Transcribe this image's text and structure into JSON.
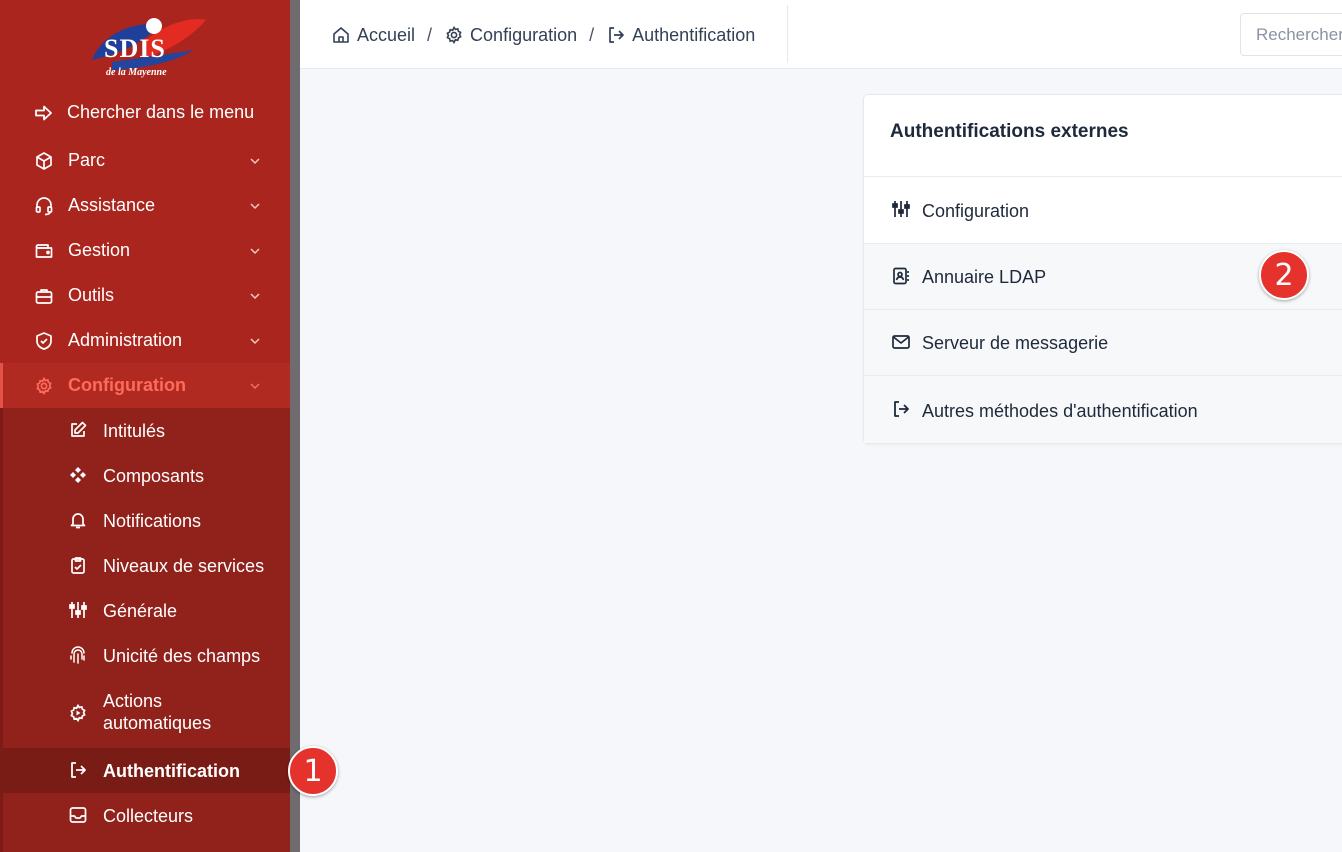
{
  "brand": {
    "logo_text": "SDIS",
    "logo_subtext": "de la Mayenne",
    "colors": {
      "sidebar": "#a9251d",
      "submenu": "#90221b",
      "active_text": "#ff6b5a",
      "badge": "#e5322d"
    }
  },
  "sidebar": {
    "search_label": "Chercher dans le menu",
    "items": [
      {
        "label": "Parc",
        "icon": "box-icon"
      },
      {
        "label": "Assistance",
        "icon": "headset-icon"
      },
      {
        "label": "Gestion",
        "icon": "wallet-icon"
      },
      {
        "label": "Outils",
        "icon": "briefcase-icon"
      },
      {
        "label": "Administration",
        "icon": "shield-icon"
      },
      {
        "label": "Configuration",
        "icon": "gear-icon",
        "active": true
      }
    ],
    "submenu": [
      {
        "label": "Intitulés",
        "icon": "edit-icon"
      },
      {
        "label": "Composants",
        "icon": "components-icon"
      },
      {
        "label": "Notifications",
        "icon": "bell-icon"
      },
      {
        "label": "Niveaux de services",
        "icon": "clipboard-icon"
      },
      {
        "label": "Générale",
        "icon": "sliders-icon"
      },
      {
        "label": "Unicité des champs",
        "icon": "fingerprint-icon"
      },
      {
        "label_line1": "Actions",
        "label_line2": "automatiques",
        "icon": "gear-play-icon"
      },
      {
        "label": "Authentification",
        "icon": "login-icon",
        "selected": true
      },
      {
        "label": "Collecteurs",
        "icon": "inbox-icon"
      }
    ]
  },
  "breadcrumb": {
    "home": "Accueil",
    "section": "Configuration",
    "page": "Authentification",
    "separator": "/"
  },
  "search": {
    "placeholder": "Rechercher"
  },
  "card": {
    "title": "Authentifications externes",
    "rows": [
      {
        "label": "Configuration",
        "icon": "sliders-icon"
      },
      {
        "label": "Annuaire LDAP",
        "icon": "address-book-icon"
      },
      {
        "label": "Serveur de messagerie",
        "icon": "envelope-icon"
      },
      {
        "label": "Autres méthodes d'authentification",
        "icon": "login-icon"
      }
    ]
  },
  "annotations": {
    "badge1": "1",
    "badge2": "2"
  }
}
